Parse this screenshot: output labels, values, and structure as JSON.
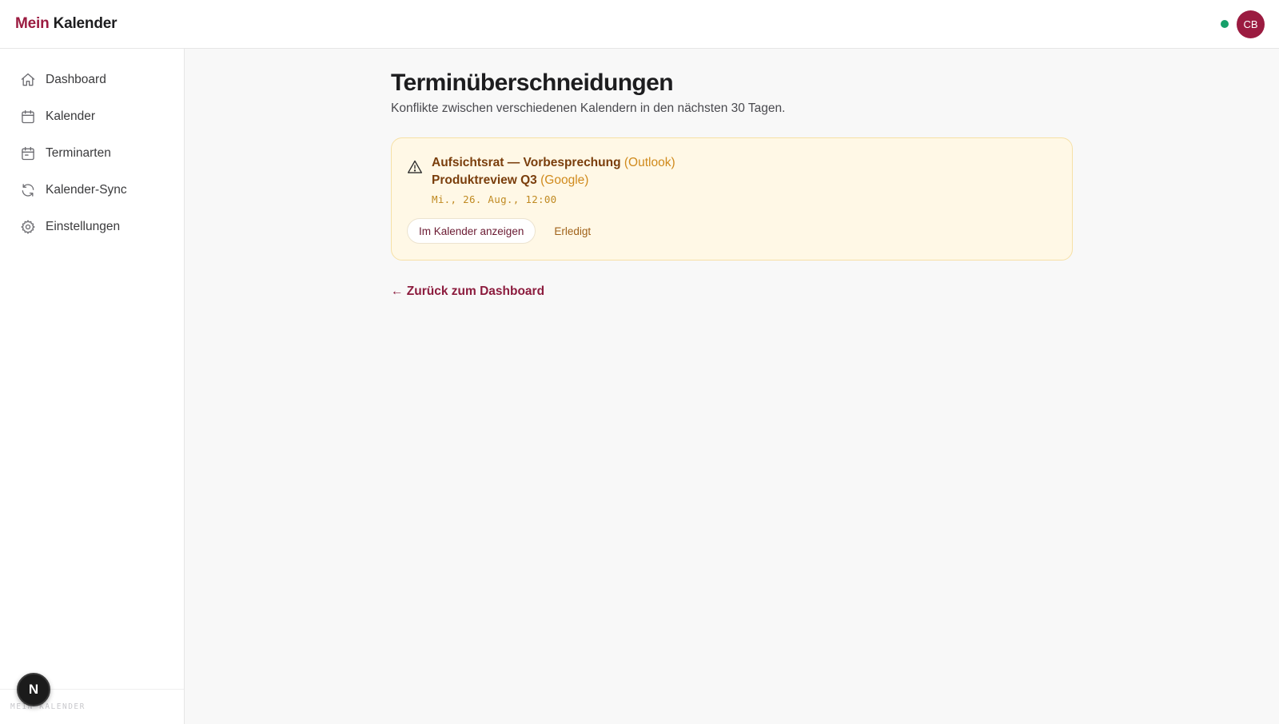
{
  "header": {
    "brand_accent": "Mein",
    "brand_rest": "Kalender",
    "status_color": "#16a06a",
    "avatar_initials": "CB"
  },
  "sidebar": {
    "items": [
      {
        "label": "Dashboard",
        "icon": "home-icon"
      },
      {
        "label": "Kalender",
        "icon": "calendar-icon"
      },
      {
        "label": "Terminarten",
        "icon": "calendar-type-icon"
      },
      {
        "label": "Kalender-Sync",
        "icon": "sync-icon"
      },
      {
        "label": "Einstellungen",
        "icon": "gear-icon"
      }
    ],
    "footer_text": "MEIN KALENDER",
    "badge_letter": "N"
  },
  "main": {
    "title": "Terminüberschneidungen",
    "subtitle": "Konflikte zwischen verschiedenen Kalendern in den nächsten 30 Tagen.",
    "conflict": {
      "icon": "warning-icon",
      "event1_title": "Aufsichtsrat — Vorbesprechung",
      "event1_source": "(Outlook)",
      "event2_title": "Produktreview Q3",
      "event2_source": "(Google)",
      "datetime": "Mi., 26. Aug., 12:00",
      "show_button": "Im Kalender anzeigen",
      "done_button": "Erledigt"
    },
    "back_link": "← Zurück zum Dashboard"
  },
  "colors": {
    "accent": "#9b1b40",
    "warning_bg": "#fff8e6",
    "warning_border": "#f6e0a6"
  }
}
